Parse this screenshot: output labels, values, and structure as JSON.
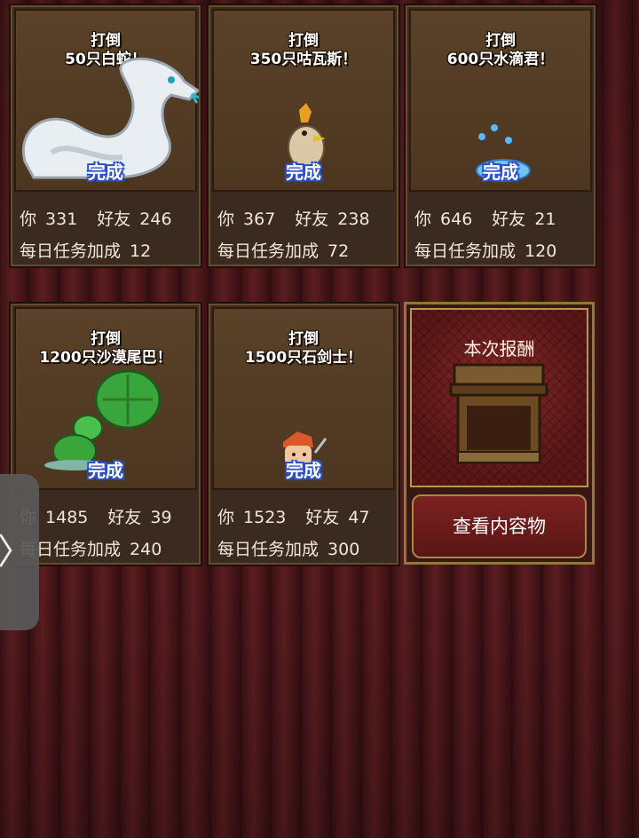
{
  "cards": [
    {
      "title_line1": "打倒",
      "title_line2": "50只白蛇！",
      "status": "完成",
      "you_label": "你",
      "you_value": "331",
      "friend_label": "好友",
      "friend_value": "246",
      "bonus_label": "每日任务加成",
      "bonus_value": "12",
      "monster_icon": "white-snake-icon"
    },
    {
      "title_line1": "打倒",
      "title_line2": "350只咕瓦斯！",
      "status": "完成",
      "you_label": "你",
      "you_value": "367",
      "friend_label": "好友",
      "friend_value": "238",
      "bonus_label": "每日任务加成",
      "bonus_value": "72",
      "monster_icon": "chicken-monster-icon"
    },
    {
      "title_line1": "打倒",
      "title_line2": "600只水滴君！",
      "status": "完成",
      "you_label": "你",
      "you_value": "646",
      "friend_label": "好友",
      "friend_value": "21",
      "bonus_label": "每日任务加成",
      "bonus_value": "120",
      "monster_icon": "water-drop-icon"
    },
    {
      "title_line1": "打倒",
      "title_line2": "1200只沙漠尾巴！",
      "status": "完成",
      "you_label": "你",
      "you_value": "1485",
      "friend_label": "好友",
      "friend_value": "39",
      "bonus_label": "每日任务加成",
      "bonus_value": "240",
      "monster_icon": "green-plant-icon"
    },
    {
      "title_line1": "打倒",
      "title_line2": "1500只石剑士！",
      "status": "完成",
      "you_label": "你",
      "you_value": "1523",
      "friend_label": "好友",
      "friend_value": "47",
      "bonus_label": "每日任务加成",
      "bonus_value": "300",
      "monster_icon": "stone-swordsman-icon"
    }
  ],
  "reward": {
    "title": "本次报酬",
    "button_label": "查看内容物",
    "icon": "treasure-chest-icon"
  },
  "side_tab": {
    "glyph": "〉",
    "icon": "chevron-right-icon"
  }
}
